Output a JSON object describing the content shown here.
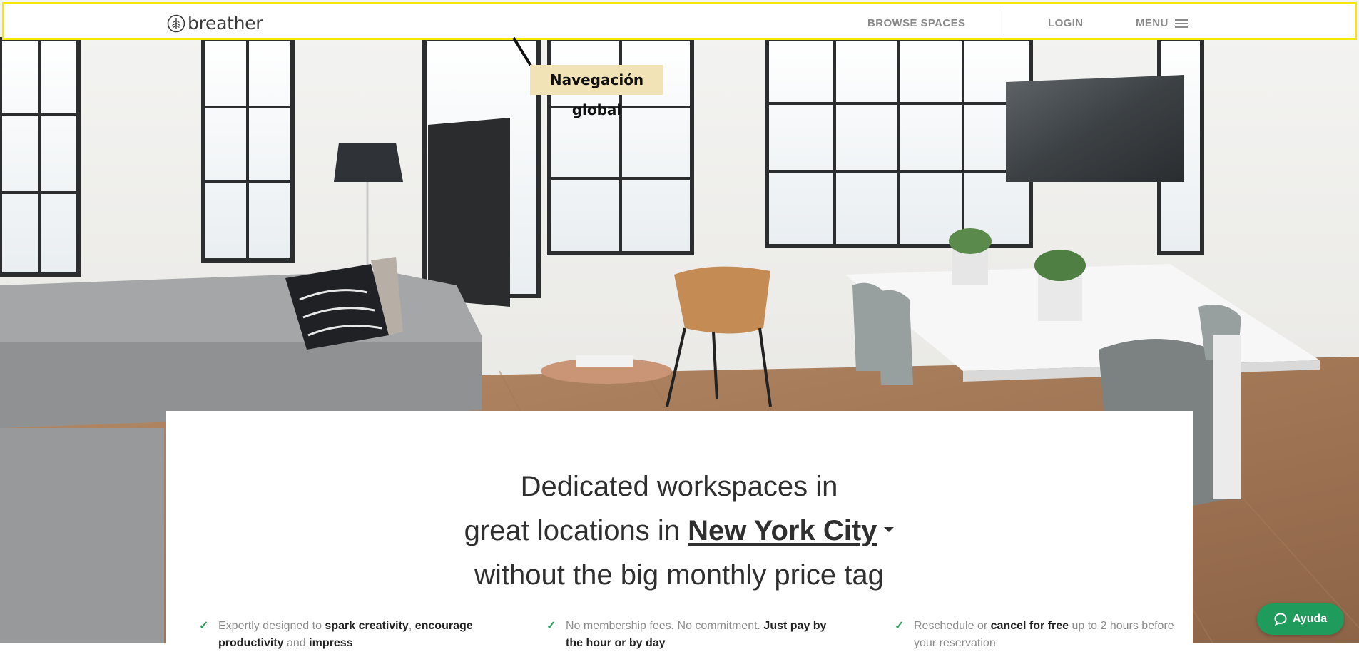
{
  "nav": {
    "logo_text": "breather",
    "browse_label": "BROWSE SPACES",
    "login_label": "LOGIN",
    "menu_label": "MENU"
  },
  "annotation": {
    "label": "Navegación global",
    "highlight_color": "#f5e800"
  },
  "hero": {
    "headline_line1": "Dedicated workspaces in",
    "headline_line2_prefix": "great locations in",
    "city": "New York City",
    "headline_line3": "without the big monthly price tag"
  },
  "features": [
    {
      "t1": "Expertly designed to ",
      "b1": "spark creativity",
      "t2": ", ",
      "b2": "encourage productivity",
      "t3": " and ",
      "b3": "impress"
    },
    {
      "t1": "No membership fees. No commitment. ",
      "b1": "Just pay by the hour or by day"
    },
    {
      "t1": "Reschedule or ",
      "b1": "cancel for free",
      "t2": " up to 2 hours before your reservation"
    }
  ],
  "help": {
    "label": "Ayuda"
  },
  "colors": {
    "accent_green": "#1f9b5b",
    "check_green": "#2c9a5c",
    "annotation_bg": "#f1e3b6"
  },
  "icons": [
    "tree-logo-icon",
    "hamburger-icon",
    "check-icon",
    "chat-bubble-icon",
    "caret-down-icon"
  ]
}
